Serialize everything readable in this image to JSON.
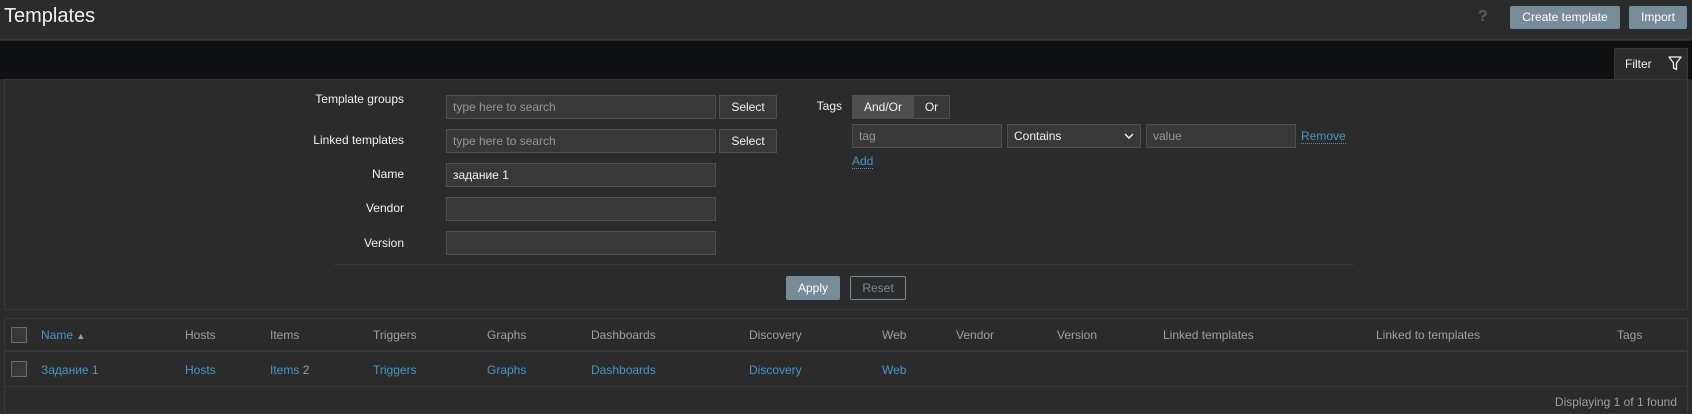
{
  "header": {
    "title": "Templates",
    "help_glyph": "?",
    "create_label": "Create template",
    "import_label": "Import"
  },
  "filter_tab": {
    "label": "Filter",
    "icon": "funnel-icon"
  },
  "filter": {
    "template_groups": {
      "label": "Template groups",
      "placeholder": "type here to search",
      "select_label": "Select"
    },
    "linked_templates": {
      "label": "Linked templates",
      "placeholder": "type here to search",
      "select_label": "Select"
    },
    "name": {
      "label": "Name",
      "value": "задание 1"
    },
    "vendor": {
      "label": "Vendor",
      "value": ""
    },
    "version": {
      "label": "Version",
      "value": ""
    },
    "tags": {
      "label": "Tags",
      "and_or": "And/Or",
      "or": "Or",
      "tag_placeholder": "tag",
      "operator": "Contains",
      "value_placeholder": "value",
      "remove_label": "Remove",
      "add_label": "Add"
    },
    "apply_label": "Apply",
    "reset_label": "Reset"
  },
  "table": {
    "columns": {
      "name": "Name",
      "hosts": "Hosts",
      "items": "Items",
      "triggers": "Triggers",
      "graphs": "Graphs",
      "dashboards": "Dashboards",
      "discovery": "Discovery",
      "web": "Web",
      "vendor": "Vendor",
      "version": "Version",
      "linked_templates": "Linked templates",
      "linked_to_templates": "Linked to templates",
      "tags": "Tags"
    },
    "sort_glyph": "▲",
    "rows": [
      {
        "name": "Задание 1",
        "hosts": "Hosts",
        "items": "Items",
        "items_count": "2",
        "triggers": "Triggers",
        "graphs": "Graphs",
        "dashboards": "Dashboards",
        "discovery": "Discovery",
        "web": "Web"
      }
    ],
    "footer": "Displaying 1 of 1 found"
  },
  "colors": {
    "background": "#2b2b2b",
    "link": "#4796c4",
    "button": "#768d99",
    "tab_strip": "#0e1012"
  }
}
